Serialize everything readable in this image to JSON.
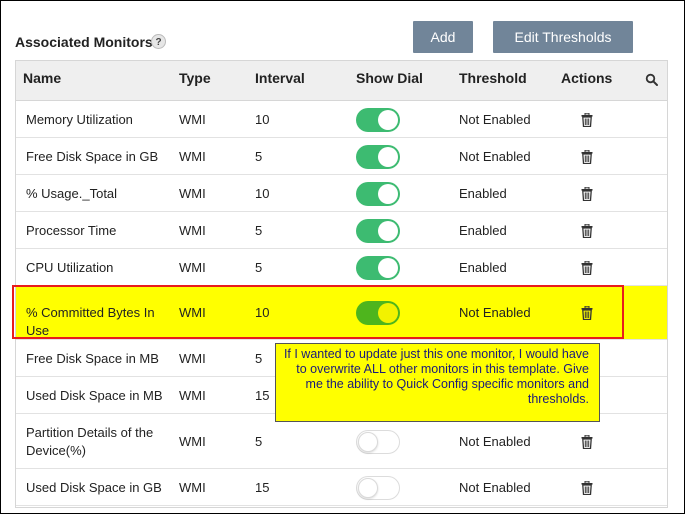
{
  "section": {
    "title": "Associated Monitors",
    "help_label": "?"
  },
  "toolbar": {
    "add_label": "Add",
    "edit_thresholds_label": "Edit Thresholds"
  },
  "table": {
    "columns": [
      "Name",
      "Type",
      "Interval",
      "Show Dial",
      "Threshold",
      "Actions"
    ],
    "rows": [
      {
        "name": "Memory Utilization",
        "type": "WMI",
        "interval": "10",
        "show_dial": true,
        "threshold": "Not Enabled"
      },
      {
        "name": "Free Disk Space in GB",
        "type": "WMI",
        "interval": "5",
        "show_dial": true,
        "threshold": "Not Enabled"
      },
      {
        "name": "% Usage._Total",
        "type": "WMI",
        "interval": "10",
        "show_dial": true,
        "threshold": "Enabled"
      },
      {
        "name": "Processor Time",
        "type": "WMI",
        "interval": "5",
        "show_dial": true,
        "threshold": "Enabled"
      },
      {
        "name": "CPU Utilization",
        "type": "WMI",
        "interval": "5",
        "show_dial": true,
        "threshold": "Enabled"
      },
      {
        "name": "% Committed Bytes In Use",
        "type": "WMI",
        "interval": "10",
        "show_dial": true,
        "threshold": "Not Enabled",
        "highlighted": true
      },
      {
        "name": "Free Disk Space in MB",
        "type": "WMI",
        "interval": "5",
        "show_dial": true,
        "threshold": ""
      },
      {
        "name": "Used Disk Space in MB",
        "type": "WMI",
        "interval": "15",
        "show_dial": true,
        "threshold": ""
      },
      {
        "name": "Partition Details of the Device(%)",
        "type": "WMI",
        "interval": "5",
        "show_dial": false,
        "threshold": "Not Enabled"
      },
      {
        "name": "Used Disk Space in GB",
        "type": "WMI",
        "interval": "15",
        "show_dial": false,
        "threshold": "Not Enabled"
      }
    ]
  },
  "annotation": {
    "text": "If I wanted to update just this one monitor, I would have to overwrite ALL other monitors in this template. Give me the ability to Quick Config specific monitors and thresholds."
  },
  "icons": {
    "search": "search-icon",
    "delete": "trash-icon",
    "help": "help-icon"
  },
  "colors": {
    "button": "#718599",
    "toggle_on": "#3dbb71",
    "highlight": "#ffff00",
    "highlight_border": "#e81c1c",
    "callout_text": "#1b1b7a"
  }
}
